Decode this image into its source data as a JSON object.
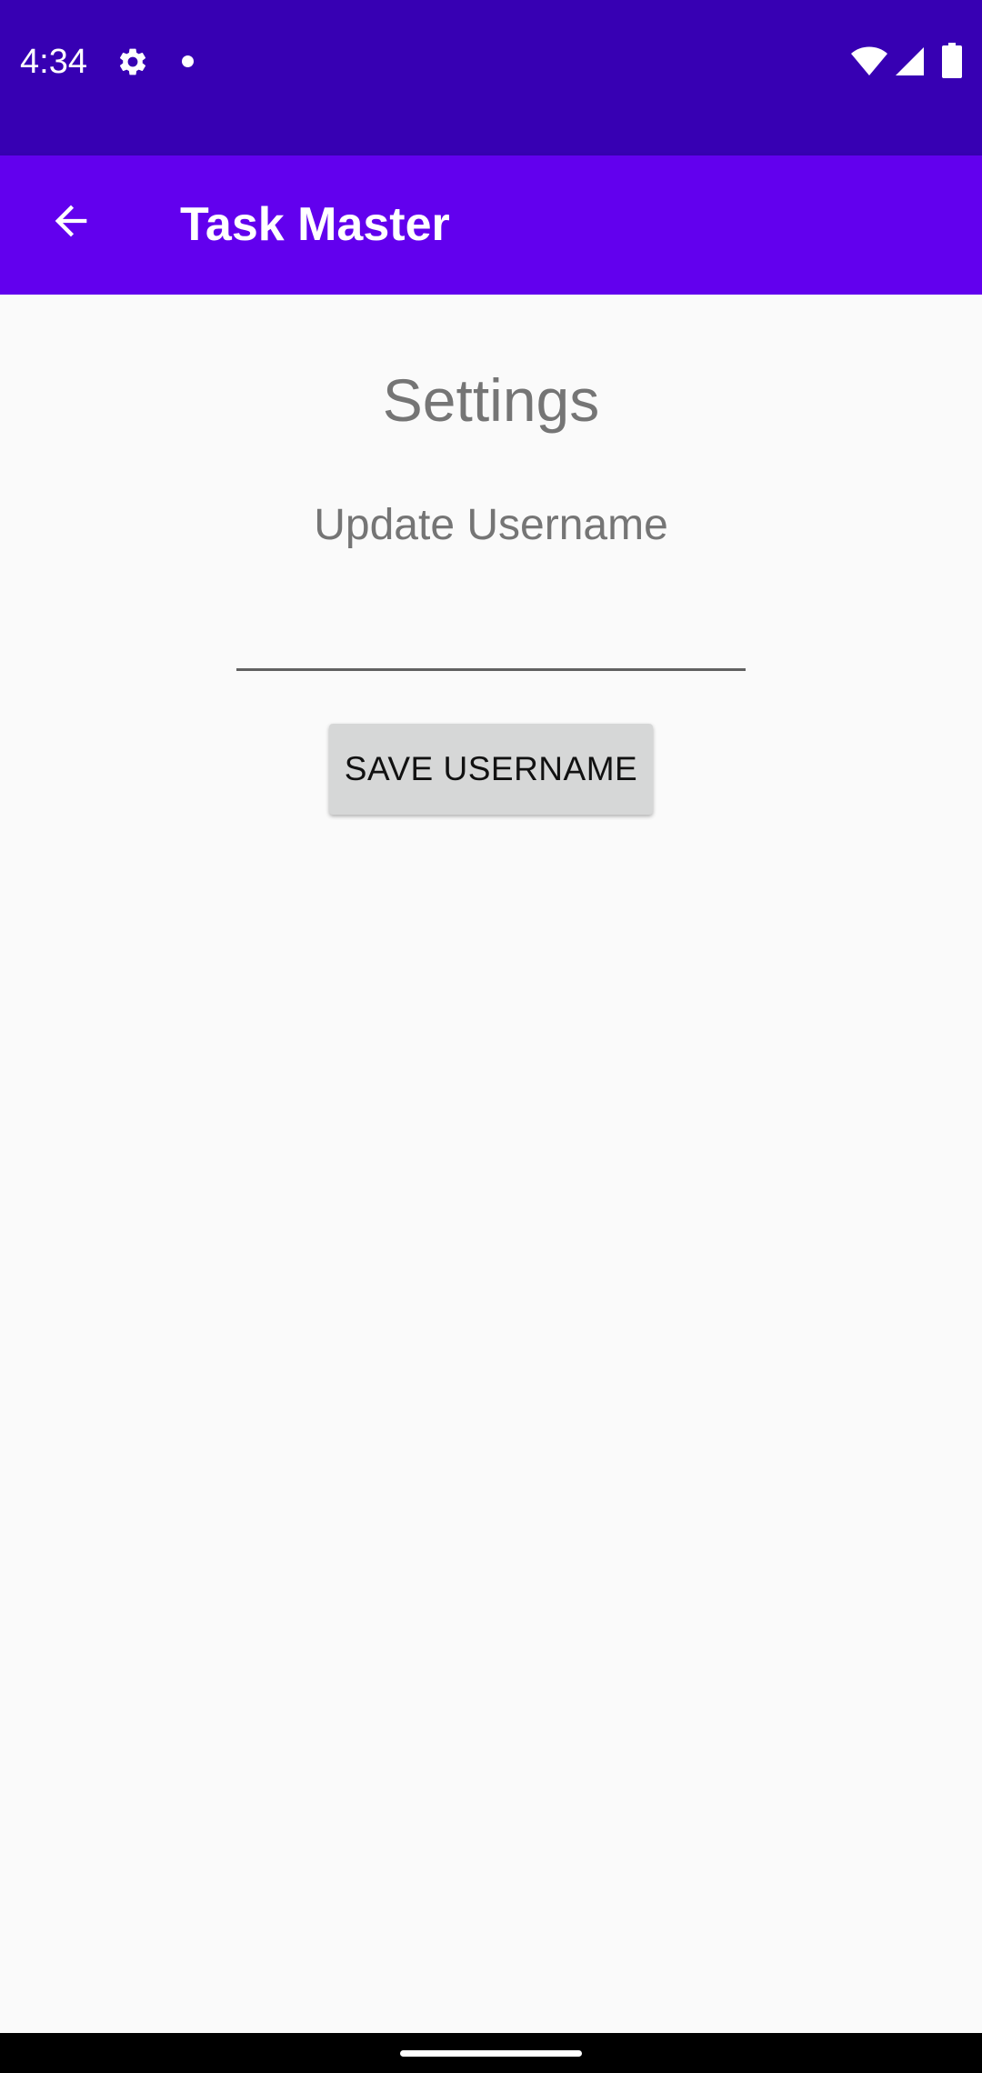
{
  "status_bar": {
    "time": "4:34",
    "icons": [
      "gear-icon",
      "notification-dot-icon",
      "wifi-icon",
      "signal-icon",
      "battery-icon"
    ]
  },
  "app_bar": {
    "title": "Task Master",
    "back_icon": "arrow-back-icon",
    "color": "#6200ee"
  },
  "main": {
    "heading": "Settings",
    "update_label": "Update Username",
    "username_input": {
      "value": "",
      "placeholder": ""
    },
    "save_button_label": "SAVE USERNAME"
  },
  "colors": {
    "status_bar": "#3700b3",
    "app_bar": "#6200ee",
    "background": "#fafafa",
    "button": "#d6d7d7"
  }
}
